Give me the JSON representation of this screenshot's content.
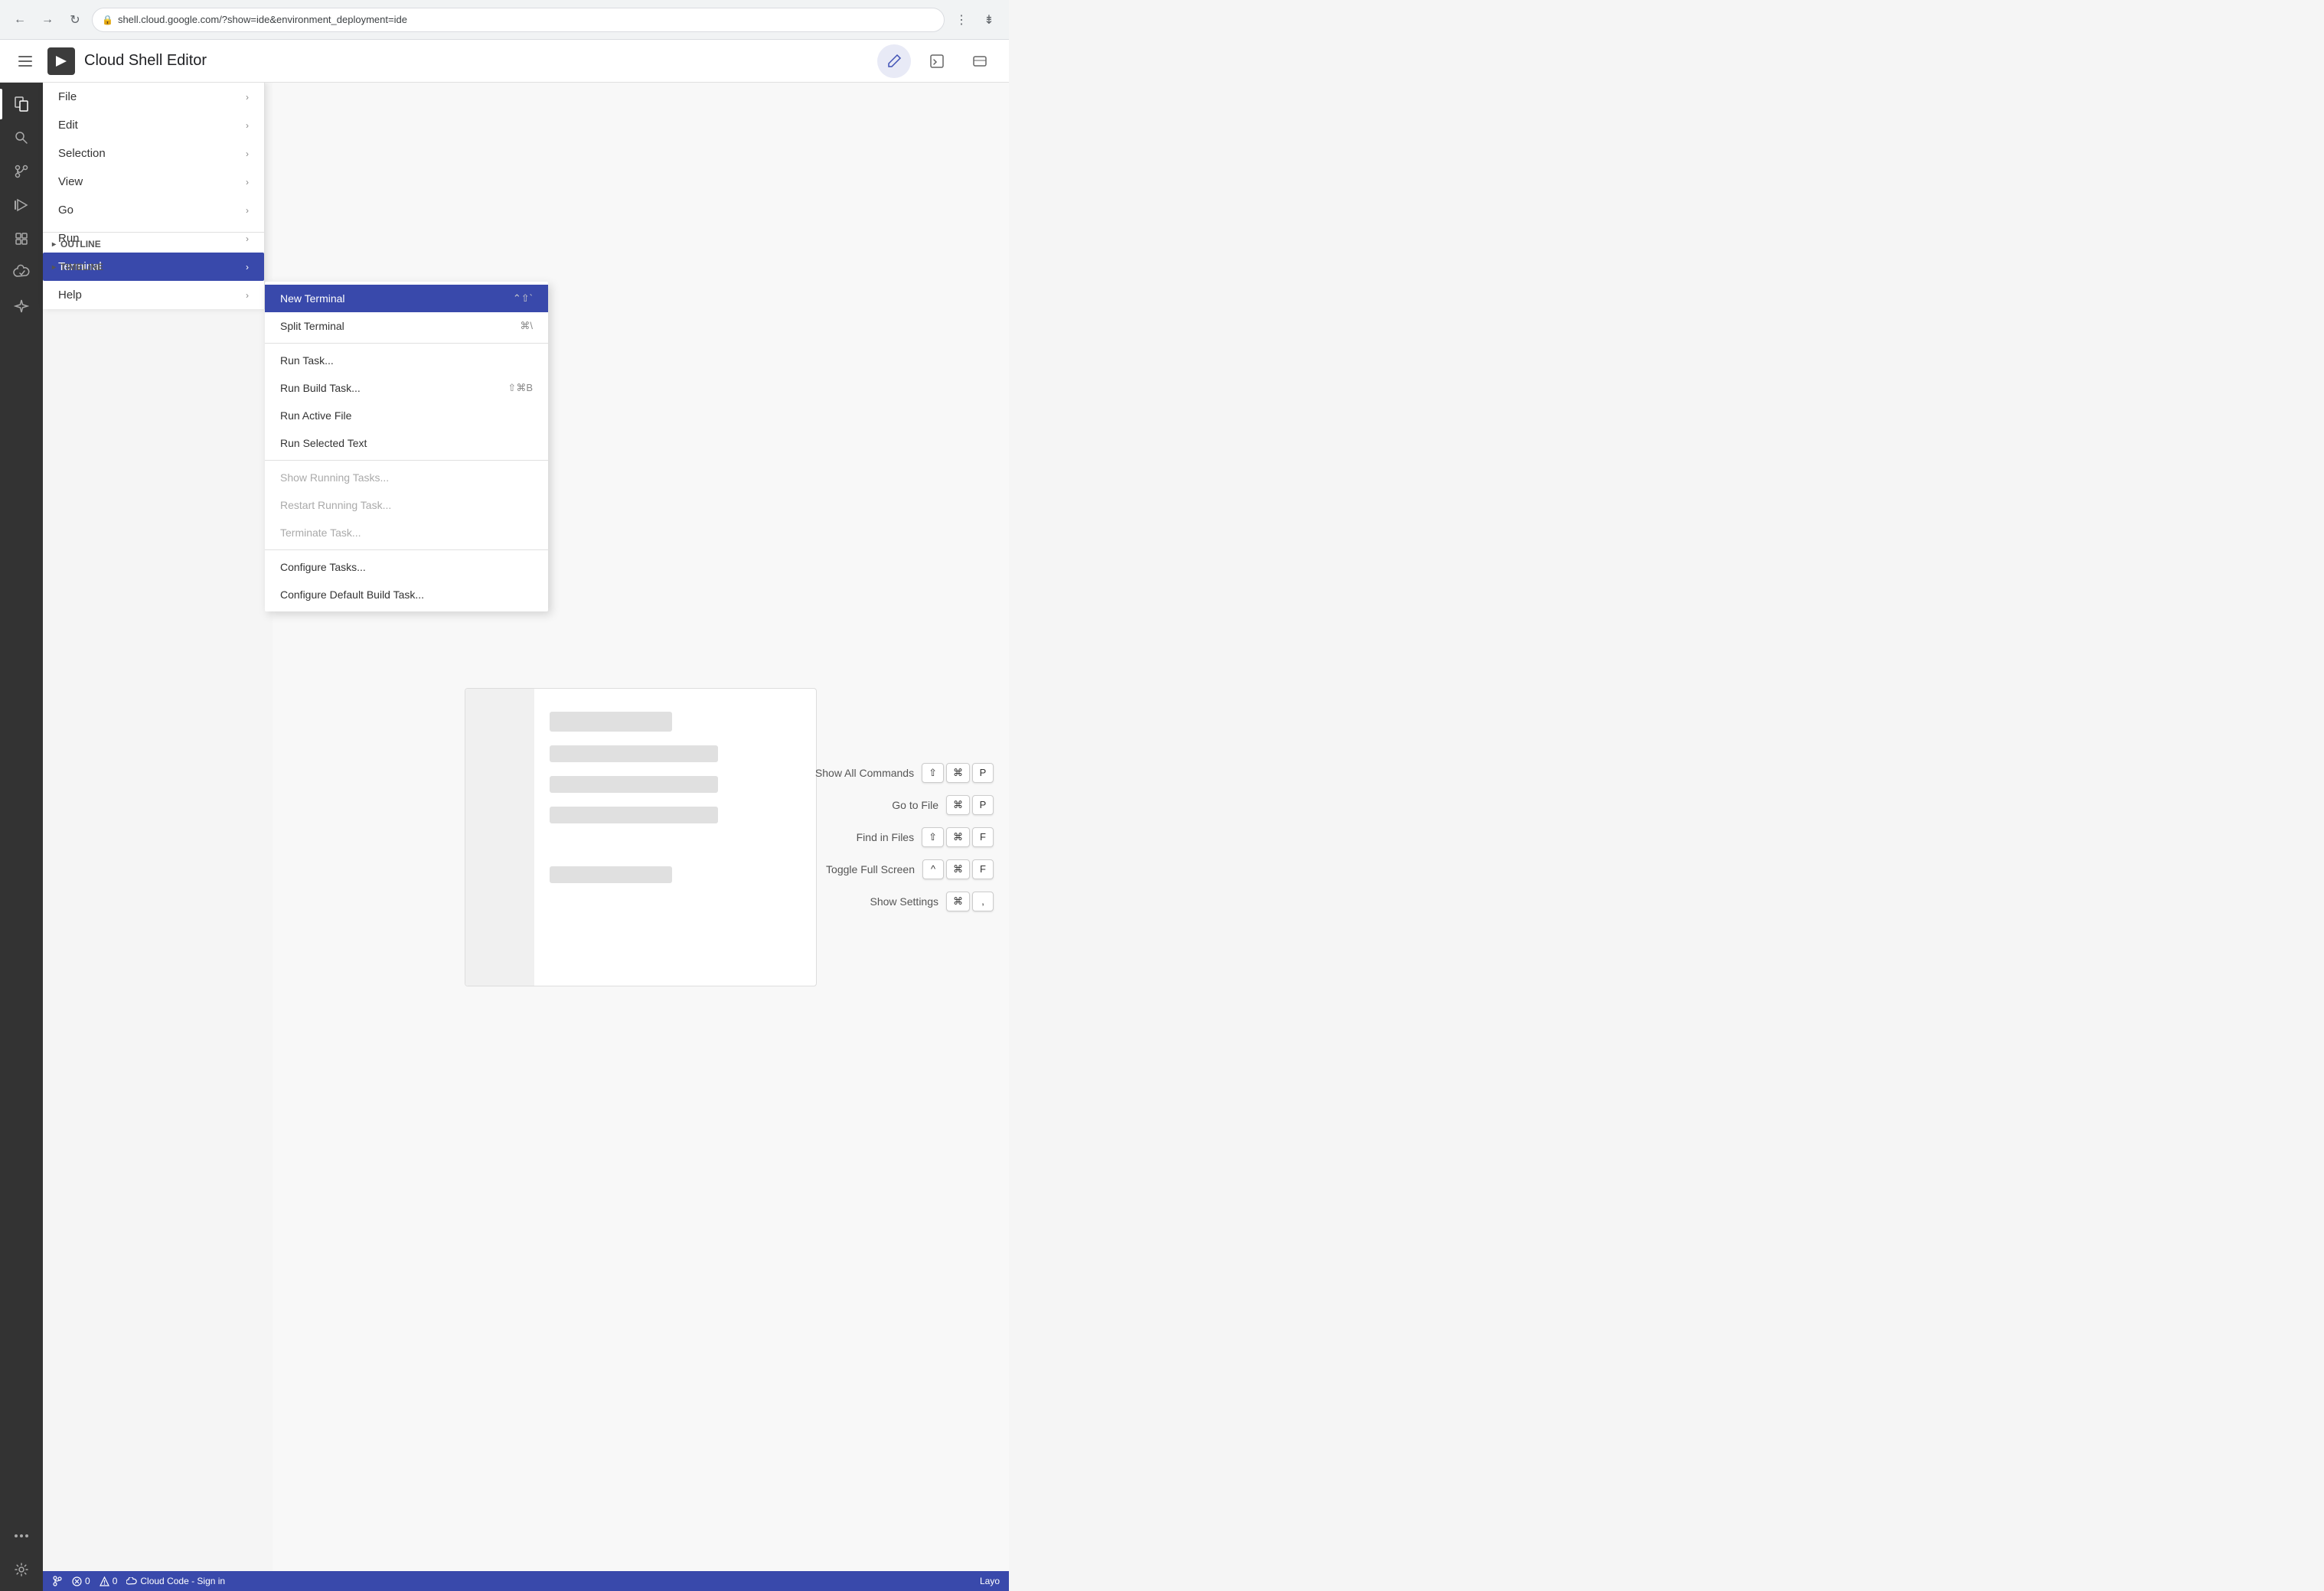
{
  "browser": {
    "url": "shell.cloud.google.com/?show=ide&environment_deployment=ide",
    "security_icon": "🔒"
  },
  "header": {
    "title": "Cloud Shell Editor",
    "logo_symbol": "▶",
    "edit_icon": "✏",
    "terminal_icon": ">_",
    "camera_icon": "▭"
  },
  "menu": {
    "items": [
      {
        "label": "File",
        "has_arrow": true
      },
      {
        "label": "Edit",
        "has_arrow": true
      },
      {
        "label": "Selection",
        "has_arrow": true
      },
      {
        "label": "View",
        "has_arrow": true
      },
      {
        "label": "Go",
        "has_arrow": true
      },
      {
        "label": "Run",
        "has_arrow": true
      },
      {
        "label": "Terminal",
        "has_arrow": true,
        "active": true
      },
      {
        "label": "Help",
        "has_arrow": true
      }
    ]
  },
  "submenu": {
    "title": "Terminal submenu",
    "items": [
      {
        "label": "New Terminal",
        "shortcut": "⌃⇧`",
        "active": true
      },
      {
        "label": "Split Terminal",
        "shortcut": "⌘\\"
      },
      {
        "divider": true
      },
      {
        "label": "Run Task...",
        "shortcut": ""
      },
      {
        "label": "Run Build Task...",
        "shortcut": "⇧⌘B"
      },
      {
        "label": "Run Active File",
        "shortcut": ""
      },
      {
        "label": "Run Selected Text",
        "shortcut": ""
      },
      {
        "divider": true
      },
      {
        "label": "Show Running Tasks...",
        "shortcut": "",
        "disabled": true
      },
      {
        "label": "Restart Running Task...",
        "shortcut": "",
        "disabled": true
      },
      {
        "label": "Terminate Task...",
        "shortcut": "",
        "disabled": true
      },
      {
        "divider": true
      },
      {
        "label": "Configure Tasks...",
        "shortcut": ""
      },
      {
        "label": "Configure Default Build Task...",
        "shortcut": ""
      }
    ]
  },
  "sidebar": {
    "items": [
      {
        "icon": "⊞",
        "name": "explorer",
        "active": true
      },
      {
        "icon": "🔍",
        "name": "search"
      },
      {
        "icon": "⑂",
        "name": "source-control"
      },
      {
        "icon": "▷",
        "name": "run"
      },
      {
        "icon": "⊟",
        "name": "extensions"
      },
      {
        "icon": "◈",
        "name": "cloud"
      },
      {
        "icon": "✦",
        "name": "ai"
      },
      {
        "icon": "···",
        "name": "more"
      }
    ],
    "bottom": {
      "settings_icon": "⚙"
    }
  },
  "commands": [
    {
      "label": "Show All Commands",
      "keys": [
        "⇧",
        "⌘",
        "P"
      ]
    },
    {
      "label": "Go to File",
      "keys": [
        "⌘",
        "P"
      ]
    },
    {
      "label": "Find in Files",
      "keys": [
        "⇧",
        "⌘",
        "F"
      ]
    },
    {
      "label": "Toggle Full Screen",
      "keys": [
        "^",
        "⌘",
        "F"
      ]
    },
    {
      "label": "Show Settings",
      "keys": [
        "⌘",
        ","
      ]
    }
  ],
  "panel": {
    "outline_label": "OUTLINE",
    "timeline_label": "TIMELINE"
  },
  "statusbar": {
    "error_count": "0",
    "warning_count": "0",
    "cloud_label": "Cloud Code - Sign in",
    "layout_label": "Layo"
  }
}
